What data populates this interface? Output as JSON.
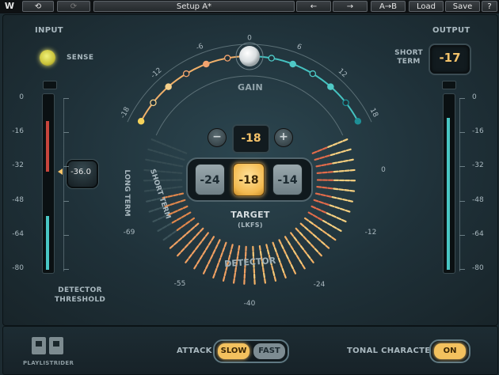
{
  "toolbar": {
    "undo": "⟲",
    "redo": "⟳",
    "preset": "Setup A*",
    "prev": "←",
    "next": "→",
    "compare": "A→B",
    "load": "Load",
    "save": "Save",
    "help": "?"
  },
  "input": {
    "title": "INPUT",
    "sense": "SENSE",
    "scale": [
      "0",
      "-16",
      "-32",
      "-48",
      "-64",
      "-80"
    ],
    "threshold_value": "-36.0",
    "threshold_label_1": "DETECTOR",
    "threshold_label_2": "THRESHOLD",
    "meter_level": 0.56
  },
  "output": {
    "title": "OUTPUT",
    "short_term_1": "SHORT",
    "short_term_2": "TERM",
    "value": "-17",
    "scale": [
      "0",
      "-16",
      "-32",
      "-48",
      "-64",
      "-80"
    ],
    "meter_level": 0.88
  },
  "gain": {
    "title": "GAIN",
    "ticks": [
      "-18",
      "-12",
      "-6",
      "0",
      "6",
      "12",
      "18"
    ],
    "value": 0
  },
  "target": {
    "minus": "−",
    "plus": "+",
    "value": "-18",
    "presets": [
      "-24",
      "-18",
      "-14"
    ],
    "label": "TARGET",
    "unit": "(LKFS)"
  },
  "detector": {
    "label": "DETECTOR",
    "long_term": "LONG TERM",
    "short_term": "SHORT TERM",
    "scale": [
      "0",
      "-12",
      "-24",
      "-40",
      "-55",
      "-69"
    ]
  },
  "bottom": {
    "logo_text": "PLAYLISTRIDER",
    "attack_label": "ATTACK",
    "slow": "SLOW",
    "fast": "FAST",
    "tonal_label": "TONAL CHARACTER",
    "tonal_state": "ON"
  },
  "colors": {
    "accent": "#f5c36a",
    "teal": "#49c6c4",
    "orange": "#e98a4a",
    "red": "#c8453c"
  }
}
